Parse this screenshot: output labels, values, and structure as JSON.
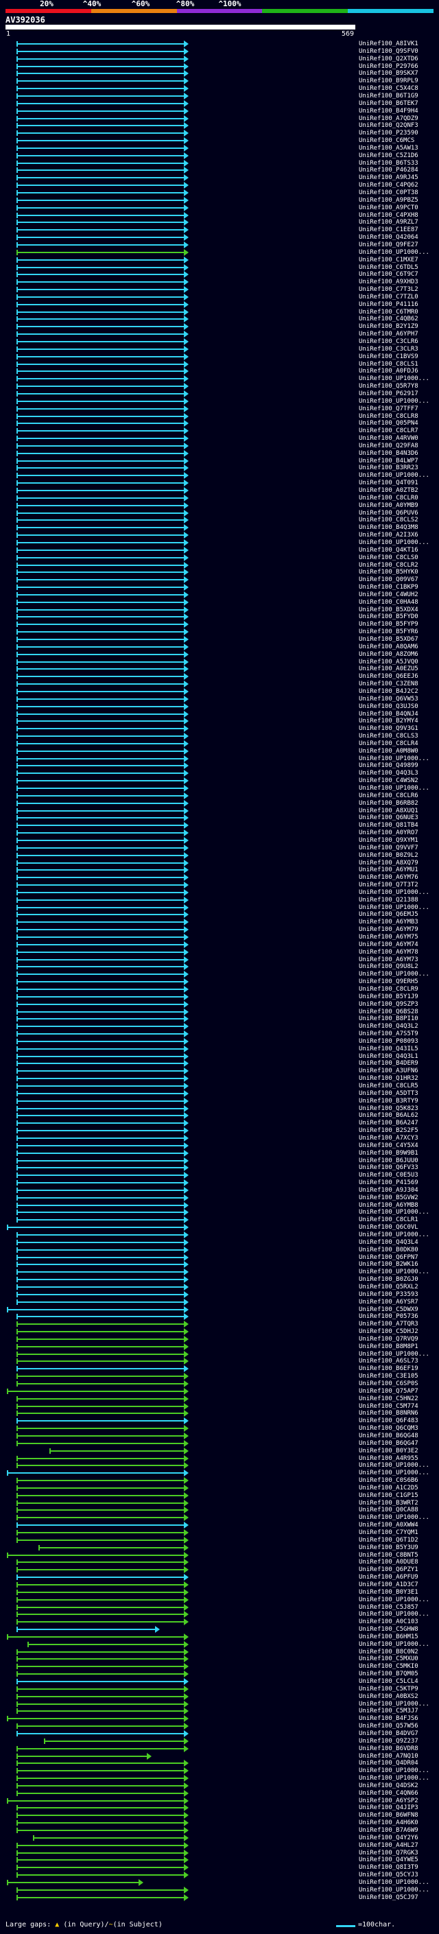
{
  "scale": {
    "labels": [
      "20%",
      "^40%",
      "^60%",
      "^80%",
      "^100%"
    ],
    "colors": [
      "#e8101e",
      "#e87f10",
      "#8e2bd6",
      "#1fb218",
      "#19c3e2"
    ]
  },
  "query": {
    "title": "AV392036",
    "start": "1",
    "end": "569"
  },
  "colors": {
    "hit_blue": "#33d6f5",
    "hit_green": "#4ccd24",
    "background": "#00001a"
  },
  "hits": [
    "UniRef100_A8IVK1",
    "UniRef100_Q9SFV0",
    "UniRef100_Q2XTD6",
    "UniRef100_P29766",
    "UniRef100_B9SKX7",
    "UniRef100_B9RPL9",
    "UniRef100_C5X4C8",
    "UniRef100_B6T1G9",
    "UniRef100_B6TEK7",
    "UniRef100_B4F9H4",
    "UniRef100_A7QDZ9",
    "UniRef100_Q2QNF3",
    "UniRef100_P23590",
    "UniRef100_C6MCS",
    "UniRef100_A5AW13",
    "UniRef100_C5Z1D6",
    "UniRef100_B6TS33",
    "UniRef100_P46284",
    "UniRef100_A9RJ45",
    "UniRef100_C4PQ62",
    "UniRef100_C0PT38",
    "UniRef100_A9PBZ5",
    "UniRef100_A9PCT0",
    "UniRef100_C4PXH8",
    "UniRef100_A9RZL7",
    "UniRef100_C1EE87",
    "UniRef100_Q42064",
    "UniRef100_Q9FE27",
    "UniRef100_UP1000...",
    "UniRef100_C1MXE7",
    "UniRef100_C6TDL5",
    "UniRef100_C6T9C7",
    "UniRef100_A9XHD3",
    "UniRef100_C7T3L2",
    "UniRef100_C7TZL0",
    "UniRef100_P41116",
    "UniRef100_C6TMR0",
    "UniRef100_C4QB62",
    "UniRef100_B2Y1Z9",
    "UniRef100_A6YPH7",
    "UniRef100_C3CLR6",
    "UniRef100_C3CLR3",
    "UniRef100_C1BVS9",
    "UniRef100_C8CLS1",
    "UniRef100_A0FDJ6",
    "UniRef100_UP1000...",
    "UniRef100_Q5R7Y8",
    "UniRef100_P62917",
    "UniRef100_UP1000...",
    "UniRef100_Q7TFF7",
    "UniRef100_C8CLR8",
    "UniRef100_Q05PN4",
    "UniRef100_C8CLR7",
    "UniRef100_A4RVW0",
    "UniRef100_Q29FA8",
    "UniRef100_B4N3D6",
    "UniRef100_B4LWP7",
    "UniRef100_B3RR23",
    "UniRef100_UP1000...",
    "UniRef100_Q4T091",
    "UniRef100_A0ZTB2",
    "UniRef100_C8CLR0",
    "UniRef100_A0YMB9",
    "UniRef100_Q6PUV6",
    "UniRef100_C8CLS2",
    "UniRef100_B4Q3M8",
    "UniRef100_A2I3X6",
    "UniRef100_UP1000...",
    "UniRef100_Q4KT16",
    "UniRef100_C8CLS0",
    "UniRef100_C8CLR2",
    "UniRef100_B5HYK0",
    "UniRef100_Q09V67",
    "UniRef100_C1BKP9",
    "UniRef100_C4WUH2",
    "UniRef100_C0HA48",
    "UniRef100_B5XDX4",
    "UniRef100_B5FYD0",
    "UniRef100_B5FYP9",
    "UniRef100_B5FYR6",
    "UniRef100_B5XD67",
    "UniRef100_A8QAM6",
    "UniRef100_A8ZOM6",
    "UniRef100_A5JVQ0",
    "UniRef100_A0EZU5",
    "UniRef100_Q6EEJ6",
    "UniRef100_C3ZEN8",
    "UniRef100_B4J2C2",
    "UniRef100_Q6VW53",
    "UniRef100_Q3UJS0",
    "UniRef100_B4QNJ4",
    "UniRef100_B2YMY4",
    "UniRef100_Q9V3G1",
    "UniRef100_C8CLS3",
    "UniRef100_C8CLR4",
    "UniRef100_A0M8W0",
    "UniRef100_UP1000...",
    "UniRef100_Q49899",
    "UniRef100_Q4Q3L3",
    "UniRef100_C4WSN2",
    "UniRef100_UP1000...",
    "UniRef100_C8CLR6",
    "UniRef100_B6RB82",
    "UniRef100_A8XUQ1",
    "UniRef100_Q6NUE3",
    "UniRef100_Q81TB4",
    "UniRef100_A0YRO7",
    "UniRef100_Q9XYM1",
    "UniRef100_Q9VVF7",
    "UniRef100_B0Z9L2",
    "UniRef100_A8XQ79",
    "UniRef100_A6YMU1",
    "UniRef100_A6YM76",
    "UniRef100_Q7T3T2",
    "UniRef100_UP1000...",
    "UniRef100_Q21388",
    "UniRef100_UP1000...",
    "UniRef100_Q6EMJ5",
    "UniRef100_A6YMB3",
    "UniRef100_A6YM79",
    "UniRef100_A6YM75",
    "UniRef100_A6YM74",
    "UniRef100_A6YM78",
    "UniRef100_A6YM73",
    "UniRef100_Q9U8L2",
    "UniRef100_UP1000...",
    "UniRef100_Q9ERH5",
    "UniRef100_C8CLR9",
    "UniRef100_B5Y1J9",
    "UniRef100_Q9SZP3",
    "UniRef100_Q6BS28",
    "UniRef100_B8PI10",
    "UniRef100_Q4Q3L2",
    "UniRef100_A7S5T9",
    "UniRef100_P08093",
    "UniRef100_Q43IL5",
    "UniRef100_Q4Q3L1",
    "UniRef100_B4DER9",
    "UniRef100_A3UFN6",
    "UniRef100_Q1HR32",
    "UniRef100_C8CLR5",
    "UniRef100_A5DTT3",
    "UniRef100_B3RTY9",
    "UniRef100_Q5K823",
    "UniRef100_B6AL62",
    "UniRef100_B6A247",
    "UniRef100_B2S2F5",
    "UniRef100_A7XCY3",
    "UniRef100_C4Y5X4",
    "UniRef100_B9W9B1",
    "UniRef100_B6JUU0",
    "UniRef100_Q6FV33",
    "UniRef100_C0E5U3",
    "UniRef100_P41569",
    "UniRef100_A9J304",
    "UniRef100_B5GVW2",
    "UniRef100_A6YMB8",
    "UniRef100_UP1000...",
    "UniRef100_C8CLR1",
    "UniRef100_Q6C0VL",
    "UniRef100_UP1000...",
    "UniRef100_Q4Q3L4",
    "UniRef100_B0DK80",
    "UniRef100_Q6FPN7",
    "UniRef100_B2WK16",
    "UniRef100_UP1000...",
    "UniRef100_B0ZGJ0",
    "UniRef100_Q5RXL2",
    "UniRef100_P33593",
    "UniRef100_A6YSR7",
    "UniRef100_C5DWX9",
    "UniRef100_P05736",
    "UniRef100_A7TQR3",
    "UniRef100_C5DHJ2",
    "UniRef100_Q7RVQ9",
    "UniRef100_B8M8P1",
    "UniRef100_UP1000...",
    "UniRef100_A6SL73",
    "UniRef100_B6EF19",
    "UniRef100_C3E105",
    "UniRef100_C6SP0S",
    "UniRef100_Q75AP7",
    "UniRef100_C5HN22",
    "UniRef100_C5M774",
    "UniRef100_B8NRN6",
    "UniRef100_Q6F483",
    "UniRef100_Q6CQM3",
    "UniRef100_B6QG48",
    "UniRef100_B6QG47",
    "UniRef100_B0Y3E2",
    "UniRef100_A4R955",
    "UniRef100_UP1000...",
    "UniRef100_UP1000...",
    "UniRef100_C0S6B6",
    "UniRef100_A1C2D5",
    "UniRef100_C1GP15",
    "UniRef100_B3WRT2",
    "UniRef100_Q0CA88",
    "UniRef100_UP1000...",
    "UniRef100_A0XWW4",
    "UniRef100_C7YQM1",
    "UniRef100_Q6T1D2",
    "UniRef100_B5Y3U9",
    "UniRef100_C8BNT5",
    "UniRef100_A0DUE8",
    "UniRef100_Q6PZY1",
    "UniRef100_A6PFU9",
    "UniRef100_A1D3C7",
    "UniRef100_B0Y3E1",
    "UniRef100_UP1000...",
    "UniRef100_C5J857",
    "UniRef100_UP1000...",
    "UniRef100_A0C103",
    "UniRef100_C5GHW8",
    "UniRef100_B6HM15",
    "UniRef100_UP1000...",
    "UniRef100_B8C0N2",
    "UniRef100_C5MXU0",
    "UniRef100_C5MKI0",
    "UniRef100_B7QM05",
    "UniRef100_C5LCL4",
    "UniRef100_C5KTP9",
    "UniRef100_A0BXS2",
    "UniRef100_UP1000...",
    "UniRef100_C5M3J7",
    "UniRef100_B4FJS6",
    "UniRef100_Q57W56",
    "UniRef100_B4DVG7",
    "UniRef100_Q9Z237",
    "UniRef100_B6VDR8",
    "UniRef100_A7NQ10",
    "UniRef100_Q4DR04",
    "UniRef100_UP1000...",
    "UniRef100_UP1000...",
    "UniRef100_Q4DSK2",
    "UniRef100_C4QN66",
    "UniRef100_A6YSP2",
    "UniRef100_Q4JIP3",
    "UniRef100_B6WFN8",
    "UniRef100_A4H6K0",
    "UniRef100_B7A6W9",
    "UniRef100_Q4Y2Y6",
    "UniRef100_A4HL27",
    "UniRef100_Q7RGK3",
    "UniRef100_Q4YWE5",
    "UniRef100_Q8I3T9",
    "UniRef100_Q5CYJ3",
    "UniRef100_UP1000...",
    "UniRef100_UP1000...",
    "UniRef100_Q5CJ97"
  ],
  "footer": {
    "text": "Large gaps:",
    "icon_label": "(in Query)/",
    "icon_label2": "(in Subject)",
    "legend": "=100char."
  }
}
